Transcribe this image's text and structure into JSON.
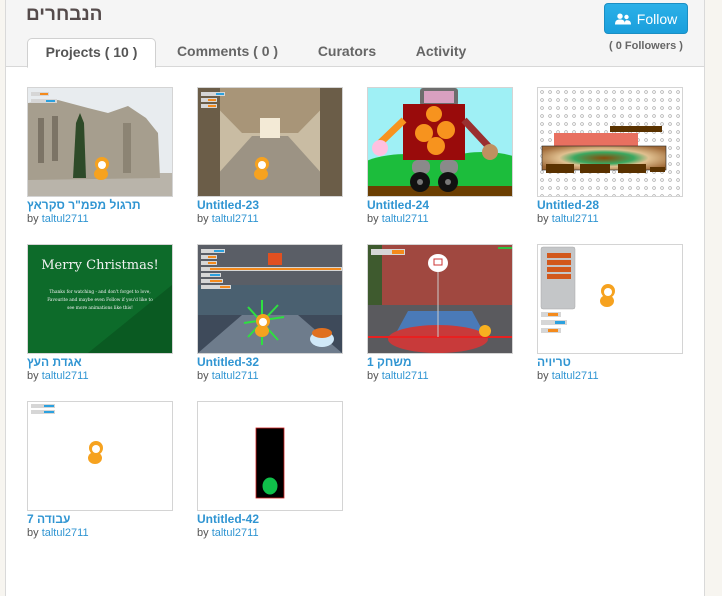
{
  "studio": {
    "title": "הנבחרים",
    "follow_label": "Follow",
    "followers_text": "( 0 Followers )",
    "accent_color": "#1da3e0"
  },
  "tabs": [
    {
      "label": "Projects ( 10 )",
      "active": true
    },
    {
      "label": "Comments ( 0 )",
      "active": false
    },
    {
      "label": "Curators",
      "active": false
    },
    {
      "label": "Activity",
      "active": false
    }
  ],
  "projects": [
    {
      "title": "תרגול מפמ\"ר סקראץ",
      "by": "by",
      "author": "taltul2711",
      "thumb": "palace-with-cat"
    },
    {
      "title": "Untitled-23",
      "by": "by",
      "author": "taltul2711",
      "thumb": "arcade-with-cat"
    },
    {
      "title": "Untitled-24",
      "by": "by",
      "author": "taltul2711",
      "thumb": "robot-on-wheels"
    },
    {
      "title": "Untitled-28",
      "by": "by",
      "author": "taltul2711",
      "thumb": "tank-drawing"
    },
    {
      "title": "אגדת העץ",
      "by": "by",
      "author": "taltul2711",
      "thumb": "merry-christmas-card",
      "card_heading": "Merry Christmas!",
      "card_text": "Thanks for watching - and don't forget to love, Favourite and maybe even Follow if you'd like to see more animations like this!"
    },
    {
      "title": "Untitled-32",
      "by": "by",
      "author": "taltul2711",
      "thumb": "store-with-cat"
    },
    {
      "title": "משחק 1",
      "by": "by",
      "author": "taltul2711",
      "thumb": "basketball-court"
    },
    {
      "title": "טריויה",
      "by": "by",
      "author": "taltul2711",
      "thumb": "list-with-cat"
    },
    {
      "title": "עבודה 7",
      "by": "by",
      "author": "taltul2711",
      "thumb": "cat-on-white"
    },
    {
      "title": "Untitled-42",
      "by": "by",
      "author": "taltul2711",
      "thumb": "traffic-light"
    }
  ]
}
